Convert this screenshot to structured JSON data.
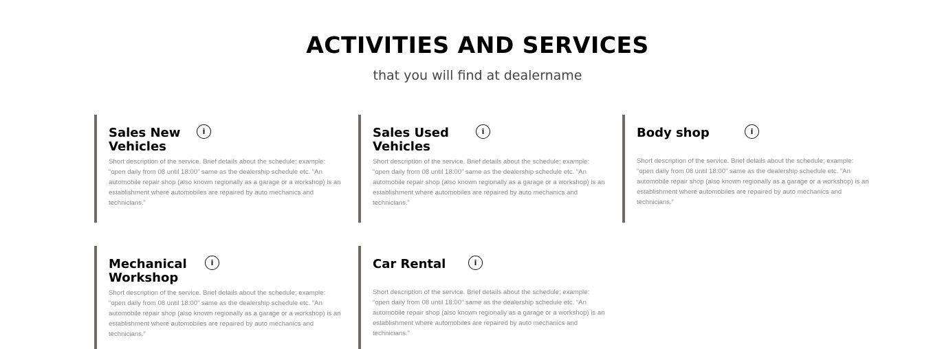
{
  "header": {
    "title": "ACTIVITIES AND SERVICES",
    "subtitle": "that you will find at dealername"
  },
  "services": [
    {
      "title": "Sales New Vehicles",
      "info_icon": "info-icon",
      "description": "Short description of the service. Brief details about the schedule; example: “open daily from 08 until 18:00” same as the  dealership schedule etc. “An automobile repair shop (also known regionally as a garage or a workshop) is an establishment where automobiles are repaired by auto mechanics and technicians.”"
    },
    {
      "title": "Sales Used Vehicles",
      "info_icon": "info-icon",
      "description": "Short description of the service. Brief details about the schedule; example: “open daily from 08 until 18:00” same as the  dealership schedule etc. “An automobile repair shop (also known regionally as a garage or a workshop) is an establishment where automobiles are repaired by auto mechanics and technicians.”"
    },
    {
      "title": "Body shop",
      "info_icon": "info-icon",
      "description": "Short description of the service. Brief details about the schedule; example: “open daily from 08 until 18:00” same as the  dealership schedule etc. “An automobile repair shop (also known regionally as a garage or a workshop) is an establishment where automobiles are repaired by auto mechanics and technicians.”"
    },
    {
      "title": "Mechanical Workshop",
      "info_icon": "info-icon",
      "description": "Short description of the service. Brief details about the schedule; example: “open daily from 08 until 18:00” same as the  dealership schedule etc. “An automobile repair shop (also known regionally as a garage or a workshop) is an establishment where automobiles are repaired by auto mechanics and technicians.”"
    },
    {
      "title": "Car Rental",
      "info_icon": "info-icon",
      "description": "Short description of the service. Brief details about the schedule; example: “open daily from 08 until 18:00” same as the  dealership schedule etc. “An automobile repair shop (also known regionally as a garage or a workshop) is an establishment where automobiles are repaired by auto mechanics and technicians.”"
    }
  ],
  "colors": {
    "accent_border": "#6d6d5a",
    "heading": "#000000",
    "description": "#888888"
  }
}
